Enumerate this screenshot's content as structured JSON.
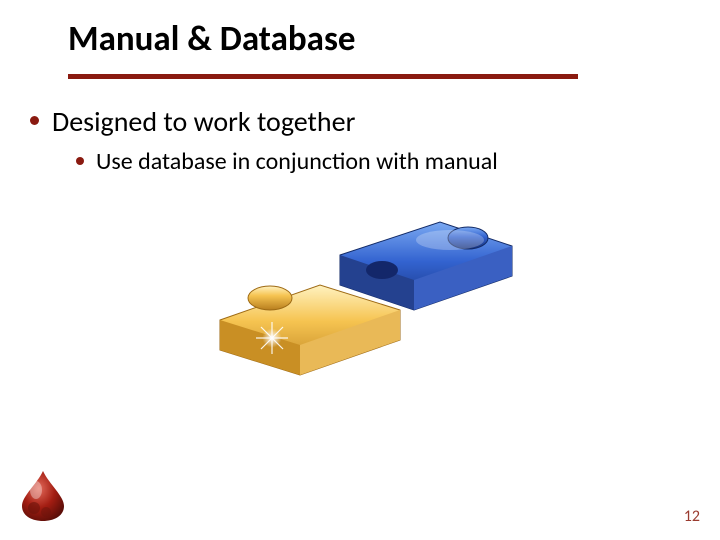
{
  "title": "Manual & Database",
  "bullets": {
    "top1": "Designed to work together",
    "sub1": "Use database in conjunction with manual"
  },
  "image": {
    "name": "puzzle-pieces-illustration"
  },
  "logo": {
    "name": "blood-drop-logo"
  },
  "page_number": "12",
  "colors": {
    "accent": "#8a1a10"
  }
}
